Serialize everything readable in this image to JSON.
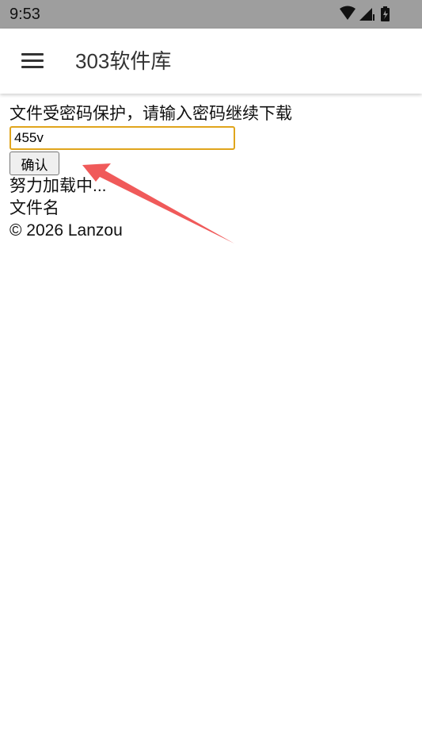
{
  "status_bar": {
    "time": "9:53",
    "icons": [
      "wifi-icon",
      "cell-signal-icon",
      "battery-charging-icon"
    ]
  },
  "app_bar": {
    "menu_icon": "hamburger-menu-icon",
    "title": "303软件库"
  },
  "main": {
    "prompt": "文件受密码保护，请输入密码继续下载",
    "password_value": "455v",
    "confirm_label": "确认",
    "loading_text": "努力加载中...",
    "file_name_label": "文件名",
    "copyright": "© 2026 Lanzou"
  },
  "colors": {
    "status_bar_bg": "#9e9e9e",
    "input_border": "#e0a51c",
    "annotation_arrow": "#f05a5a"
  }
}
